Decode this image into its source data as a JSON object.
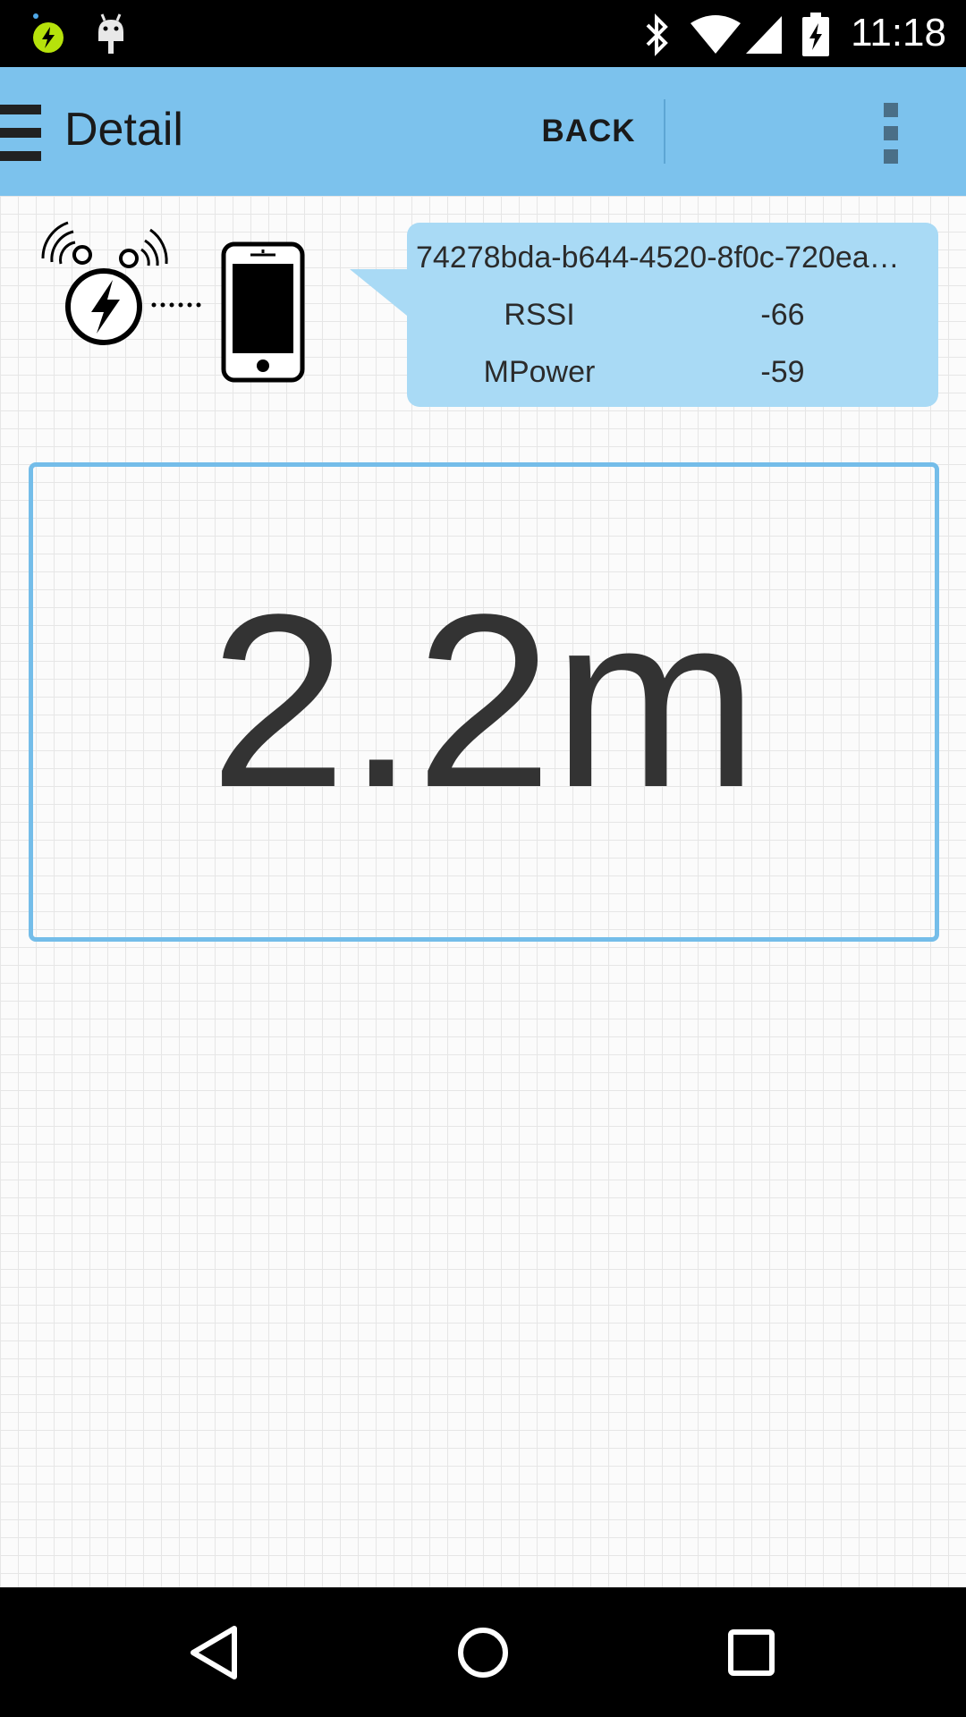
{
  "status_bar": {
    "time": "11:18",
    "icons": [
      "power-charge-notification-icon",
      "android-notification-icon",
      "bluetooth-icon",
      "wifi-icon",
      "signal-icon",
      "battery-charging-icon"
    ]
  },
  "app_bar": {
    "menu_icon": "hamburger-menu-icon",
    "title": "Detail",
    "back_label": "BACK",
    "overflow_icon": "overflow-menu-icon",
    "color": "#7cc2ed"
  },
  "beacon": {
    "illustration_icon": "beacon-to-phone-icon",
    "uuid": "74278bda-b644-4520-8f0c-720ea…",
    "rows": [
      {
        "label": "RSSI",
        "value": "-66"
      },
      {
        "label": "MPower",
        "value": "-59"
      }
    ],
    "bubble_color": "#a9daf5"
  },
  "distance": {
    "value": "2.2m",
    "border_color": "#74bde9"
  },
  "nav_bar": {
    "buttons": [
      "back-triangle-icon",
      "home-circle-icon",
      "recents-square-icon"
    ]
  }
}
